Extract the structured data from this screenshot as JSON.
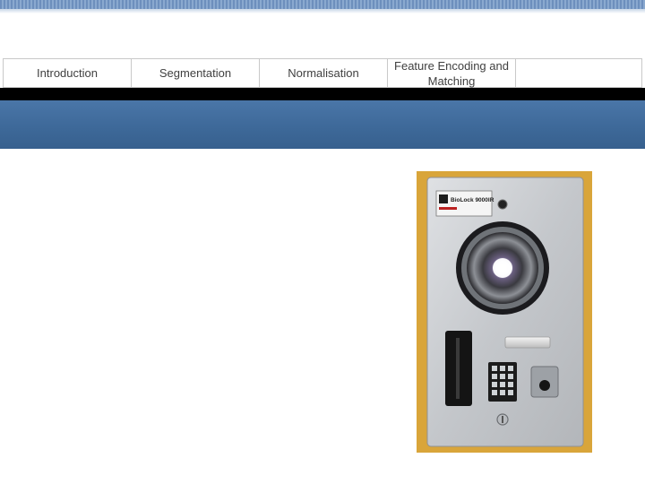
{
  "nav": {
    "tabs": [
      {
        "label": "Introduction"
      },
      {
        "label": "Segmentation"
      },
      {
        "label": "Normalisation"
      },
      {
        "label": "Feature Encoding and Matching"
      },
      {
        "label": ""
      }
    ]
  },
  "device": {
    "brand_text": "BioLock 9000IR",
    "icon": "iris-scanner-device"
  },
  "colors": {
    "banner": "#3d6898",
    "frame": "#d9a53a",
    "panel": "#c9ccd0"
  }
}
